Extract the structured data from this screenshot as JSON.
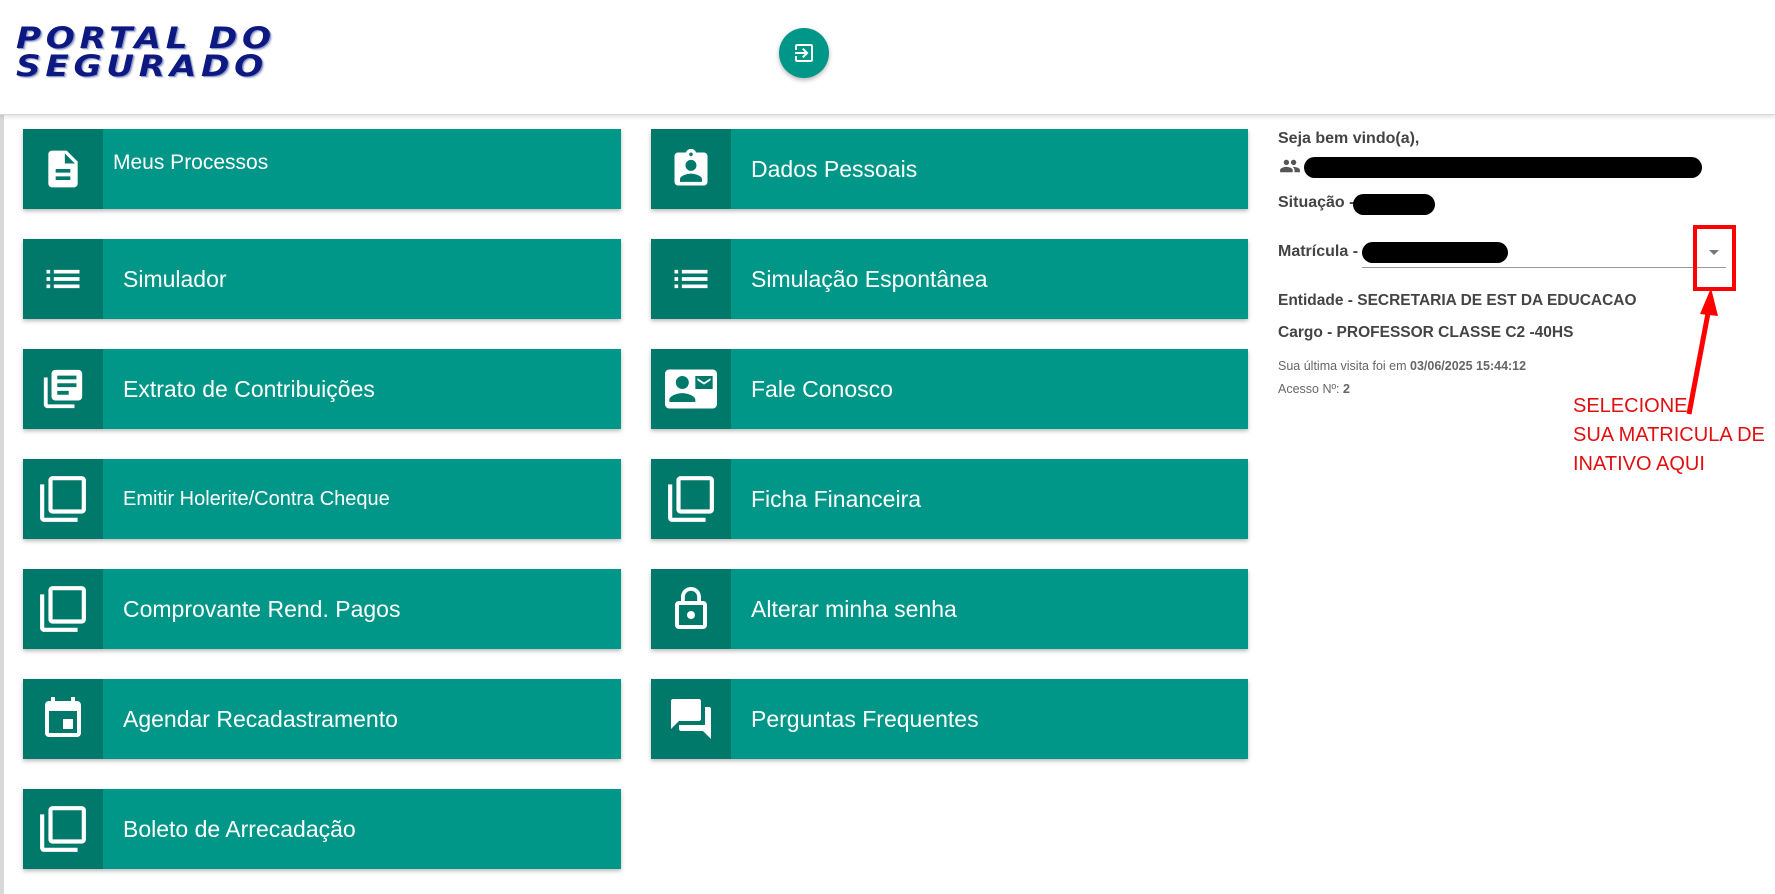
{
  "header": {
    "logo_line1": "PORTAL DO",
    "logo_line2": "SEGURADO",
    "logout_icon": "logout-icon"
  },
  "tiles": [
    {
      "label": "Meus Processos",
      "icon": "document-icon"
    },
    {
      "label": "Dados Pessoais",
      "icon": "badge-icon"
    },
    {
      "label": "Simulador",
      "icon": "list-icon"
    },
    {
      "label": "Simulação Espontânea",
      "icon": "list-icon"
    },
    {
      "label": "Extrato de Contribuições",
      "icon": "library-books-icon"
    },
    {
      "label": "Fale Conosco",
      "icon": "contact-mail-icon"
    },
    {
      "label": "Emitir Holerite/Contra Cheque",
      "icon": "copy-icon"
    },
    {
      "label": "Ficha Financeira",
      "icon": "copy-icon"
    },
    {
      "label": "Comprovante Rend. Pagos",
      "icon": "copy-icon"
    },
    {
      "label": "Alterar minha senha",
      "icon": "lock-icon"
    },
    {
      "label": "Agendar Recadastramento",
      "icon": "calendar-icon"
    },
    {
      "label": "Perguntas Frequentes",
      "icon": "forum-icon"
    },
    {
      "label": "Boleto de Arrecadação",
      "icon": "copy-icon"
    }
  ],
  "info": {
    "welcome": "Seja bem vindo(a),",
    "situacao_label": "Situação -",
    "matricula_label": "Matrícula -",
    "entidade": "Entidade - SECRETARIA DE EST DA EDUCACAO",
    "cargo": "Cargo - PROFESSOR CLASSE C2 -40HS",
    "last_visit_prefix": "Sua última visita foi em",
    "last_visit_value": "03/06/2025 15:44:12",
    "access_prefix": "Acesso Nº:",
    "access_value": "2"
  },
  "annotation": {
    "line1": "SELECIONE",
    "line2": "SUA MATRICULA DE",
    "line3": "INATIVO AQUI",
    "color": "#e01010"
  },
  "colors": {
    "tile": "#009688",
    "tile_icon_bg": "#00796b",
    "logo": "#0d1880"
  }
}
